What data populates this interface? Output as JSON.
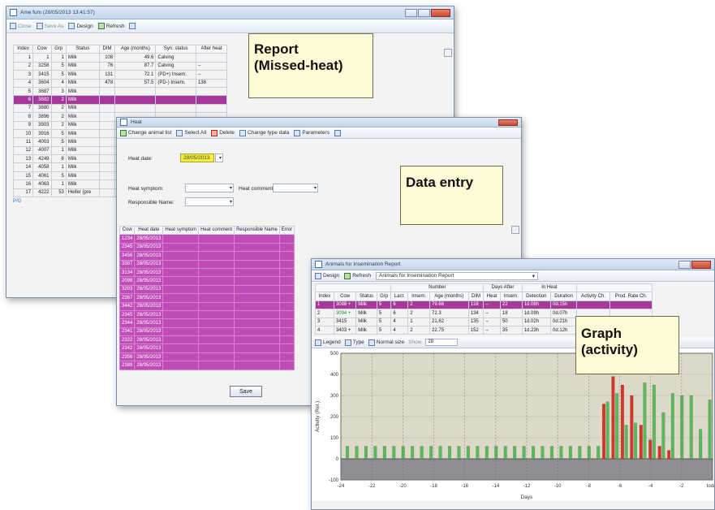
{
  "report_window": {
    "title": "Ame fum (28/05/2013 13:41:57)",
    "toolbar": {
      "close_label": "Close",
      "save_label": "Save As",
      "design_label": "Design",
      "refresh_label": "Refresh"
    },
    "columns": [
      "Index",
      "Cow",
      "Grp",
      "Status",
      "DIM",
      "Age (months)",
      "Syn. status",
      "After heat"
    ],
    "rows": [
      [
        "1",
        "1",
        "1",
        "Milk",
        "108",
        "49.6",
        "Calving",
        ""
      ],
      [
        "2",
        "3258",
        "5",
        "Milk",
        "76",
        "87.7",
        "Calving",
        "–"
      ],
      [
        "3",
        "3415",
        "5",
        "Milk",
        "131",
        "72.1",
        "(PD+) Insem.",
        "–"
      ],
      [
        "4",
        "3604",
        "4",
        "Milk",
        "478",
        "57.5",
        "(PD-) Insem.",
        "138"
      ],
      [
        "5",
        "3687",
        "3",
        "Milk",
        "",
        "",
        "",
        ""
      ],
      [
        "6",
        "3882",
        "2",
        "Milk",
        "",
        "",
        "",
        ""
      ],
      [
        "7",
        "3880",
        "2",
        "Milk",
        "",
        "",
        "",
        ""
      ],
      [
        "8",
        "3896",
        "2",
        "Milk",
        "",
        "",
        "",
        ""
      ],
      [
        "9",
        "3903",
        "2",
        "Milk",
        "",
        "",
        "",
        ""
      ],
      [
        "10",
        "3916",
        "5",
        "Milk",
        "",
        "",
        "",
        ""
      ],
      [
        "11",
        "4003",
        "5",
        "Milk",
        "",
        "",
        "",
        ""
      ],
      [
        "12",
        "4007",
        "1",
        "Milk",
        "",
        "",
        "",
        ""
      ],
      [
        "13",
        "4249",
        "8",
        "Milk",
        "",
        "",
        "",
        ""
      ],
      [
        "14",
        "4058",
        "1",
        "Milk",
        "",
        "",
        "",
        ""
      ],
      [
        "15",
        "4061",
        "5",
        "Milk",
        "",
        "",
        "",
        ""
      ],
      [
        "16",
        "4063",
        "1",
        "Milk",
        "",
        "",
        "",
        ""
      ],
      [
        "17",
        "4222",
        "53",
        "Heifer (pre",
        "",
        "",
        "",
        ""
      ]
    ],
    "selected_row_index": 5,
    "footer": "P/G"
  },
  "heat_window": {
    "title": "Heat",
    "toolbar": {
      "change_animal_label": "Change animal list",
      "select_all_label": "Select All",
      "delete_label": "Delete",
      "change_type_label": "Change type data",
      "parameters_label": "Parameters"
    },
    "heat_date_label": "Heat date:",
    "heat_date_value": "28/05/2013",
    "heat_symptom_label": "Heat symptom:",
    "heat_comment_label": "Heat comment:",
    "responsible_label": "Responsible Name:",
    "columns": [
      "Cow",
      "Heat date",
      "Heat symptom",
      "Heat comment",
      "Responsible Name",
      "Error"
    ],
    "rows": [
      [
        "1234",
        "28/05/2013"
      ],
      [
        "2345",
        "28/05/2013"
      ],
      [
        "3456",
        "28/05/2013"
      ],
      [
        "3387",
        "28/05/2013"
      ],
      [
        "3134",
        "28/05/2013"
      ],
      [
        "2098",
        "28/05/2013"
      ],
      [
        "3203",
        "28/05/2013"
      ],
      [
        "2367",
        "28/05/2013"
      ],
      [
        "3442",
        "28/05/2013"
      ],
      [
        "2345",
        "28/05/2013"
      ],
      [
        "2344",
        "28/05/2013"
      ],
      [
        "2341",
        "28/05/2013"
      ],
      [
        "2322",
        "28/05/2013"
      ],
      [
        "2342",
        "28/05/2013"
      ],
      [
        "2356",
        "28/05/2013"
      ],
      [
        "2389",
        "28/05/2013"
      ]
    ],
    "save_label": "Save"
  },
  "graph_window": {
    "title": "Animals for Insemination Report",
    "toolbar": {
      "design_label": "Design",
      "refresh_label": "Refresh",
      "report_select": "Animals for Insemination Report"
    },
    "columns": [
      "Index",
      "Cow",
      "Status",
      "Grp",
      "Lact.",
      "Insem.",
      "Age (months)",
      "DIM",
      "Heat",
      "Insem.",
      "Detection",
      "Duration",
      "Activity Ch.",
      "Prod. Rate Ch."
    ],
    "group_headers": {
      "number": "Number",
      "days_after": "Days After",
      "in_heat": "In Heat"
    },
    "rows": [
      [
        "1",
        "3088 +",
        "Milk",
        "5",
        "6",
        "2",
        "79.66",
        "128",
        "–",
        "22",
        "1d.08h",
        "0d.15h",
        "",
        ""
      ],
      [
        "2",
        "3094 +",
        "Milk",
        "5",
        "6",
        "2",
        "72.3",
        "134",
        "–",
        "18",
        "1d.09h",
        "0d.07h",
        "",
        ""
      ],
      [
        "3",
        "3415",
        "Milk",
        "5",
        "4",
        "1",
        "21.62",
        "135",
        "–",
        "50",
        "1d.02h",
        "0d.21h",
        "",
        ""
      ],
      [
        "4",
        "3403 +",
        "Milk",
        "5",
        "4",
        "2",
        "22.75",
        "152",
        "–",
        "35",
        "1d.23h",
        "0d.12h",
        "",
        ""
      ]
    ],
    "chart_toolbar": {
      "legend_label": "Legend",
      "type_label": "Type",
      "normal_size_label": "Normal size",
      "show_label": "Show",
      "show_value": "28"
    },
    "ylabel": "Activity (Rel.)",
    "xlabel": "Days"
  },
  "callouts": {
    "report": "Report\n(Missed-heat)",
    "data_entry": "Data entry",
    "graph": "Graph\n(activity)"
  },
  "chart_data": {
    "type": "bar",
    "ylabel": "Activity (Rel.)",
    "xlabel": "Days",
    "ylim": [
      -100,
      500
    ],
    "x_tick_labels": [
      "-24",
      "-22",
      "-20",
      "-18",
      "-16",
      "-14",
      "-12",
      "-10",
      "-8",
      "-6",
      "-4",
      "-2",
      "today"
    ],
    "series": [
      {
        "values": [
          60,
          60,
          60,
          60,
          60,
          60,
          60,
          60,
          60,
          60,
          60,
          60,
          60,
          60,
          60,
          60,
          60,
          60,
          60,
          60,
          60,
          60,
          60,
          60,
          60,
          60,
          60,
          60,
          270,
          310,
          160,
          170,
          360,
          350,
          220,
          310,
          300,
          300,
          140,
          280
        ],
        "color": "#5cb85c"
      },
      {
        "values": [
          0,
          0,
          0,
          0,
          0,
          0,
          0,
          0,
          0,
          0,
          0,
          0,
          0,
          0,
          0,
          0,
          0,
          0,
          0,
          0,
          0,
          0,
          0,
          0,
          0,
          0,
          0,
          0,
          260,
          390,
          350,
          300,
          160,
          90,
          60,
          40,
          0,
          0,
          0,
          0
        ],
        "color": "#d9342b"
      }
    ],
    "grid": true
  }
}
